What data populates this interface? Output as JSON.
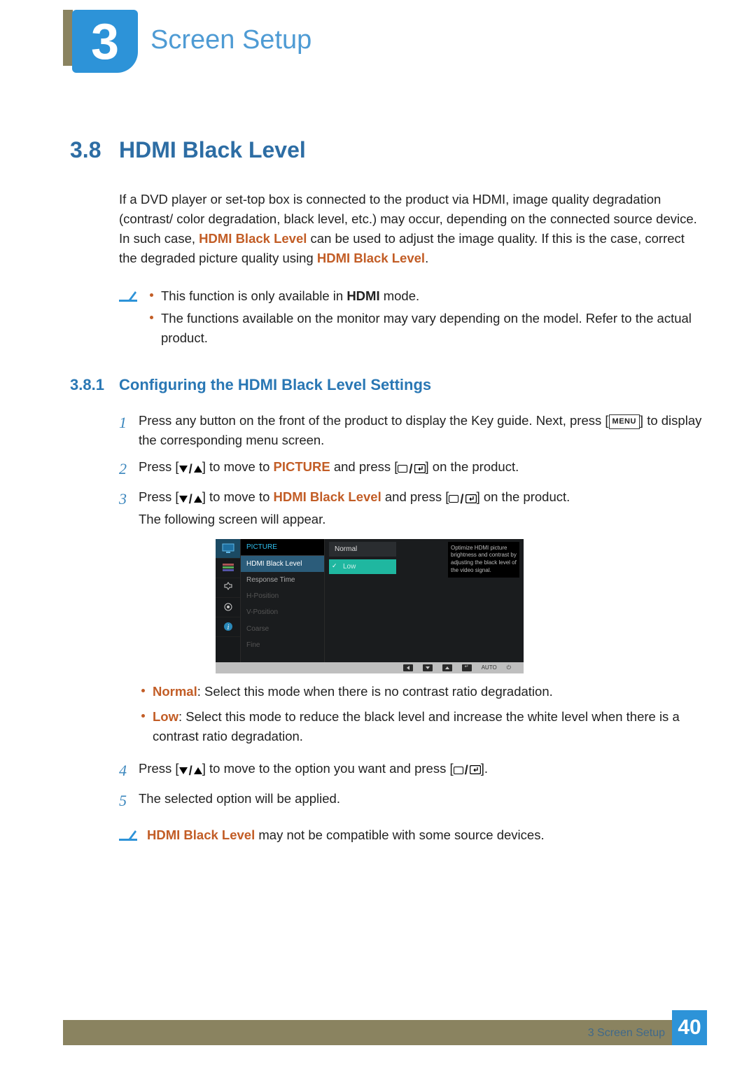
{
  "chapter": {
    "number": "3",
    "title": "Screen Setup"
  },
  "section": {
    "number": "3.8",
    "title": "HDMI Black Level"
  },
  "intro": {
    "p1a": "If a DVD player or set-top box is connected to the product via HDMI, image quality degradation (contrast/ color degradation, black level, etc.) may occur, depending on the connected source device. In such case, ",
    "t1": "HDMI Black Level",
    "p1b": " can be used to adjust the image quality. If this is the case, correct the degraded picture quality using ",
    "t2": "HDMI Black Level",
    "p1c": "."
  },
  "notes1": {
    "a_pre": "This function is only available in ",
    "a_bold": "HDMI",
    "a_post": " mode.",
    "b": "The functions available on the monitor may vary depending on the model. Refer to the actual product."
  },
  "subsection": {
    "number": "3.8.1",
    "title": "Configuring the HDMI Black Level Settings"
  },
  "steps": {
    "s1": "Press any button on the front of the product to display the Key guide. Next, press [",
    "s1_btn": "MENU",
    "s1_post": "] to display the corresponding menu screen.",
    "s2_pre": "Press [",
    "s2_mid": "] to move to ",
    "s2_pic": "PICTURE",
    "s2_post": " and press [",
    "s2_end": "] on the product.",
    "s3_pre": "Press [",
    "s3_mid": "] to move to ",
    "s3_term": "HDMI Black Level",
    "s3_post": " and press [",
    "s3_end": "] on the product.",
    "s3_line2": "The following screen will appear.",
    "s4_pre": "Press [",
    "s4_mid": "] to move to the option you want and press [",
    "s4_end": "].",
    "s5": "The selected option will be applied."
  },
  "osd": {
    "header": "PICTURE",
    "menu": [
      "HDMI Black Level",
      "Response Time",
      "H-Position",
      "V-Position",
      "Coarse",
      "Fine"
    ],
    "options": {
      "opt0": "Normal",
      "opt1": "Low"
    },
    "desc": "Optimize HDMI picture brightness and contrast by adjusting the black level of the video signal.",
    "footer": {
      "auto": "AUTO"
    }
  },
  "options_desc": {
    "normal_t": "Normal",
    "normal_d": ": Select this mode when there is no contrast ratio degradation.",
    "low_t": "Low",
    "low_d": ": Select this mode to reduce the black level and increase the white level when there is a contrast ratio degradation."
  },
  "notes2": {
    "t": "HDMI Black Level",
    "d": " may not be compatible with some source devices."
  },
  "footer": {
    "label": "3 Screen Setup",
    "page": "40"
  }
}
